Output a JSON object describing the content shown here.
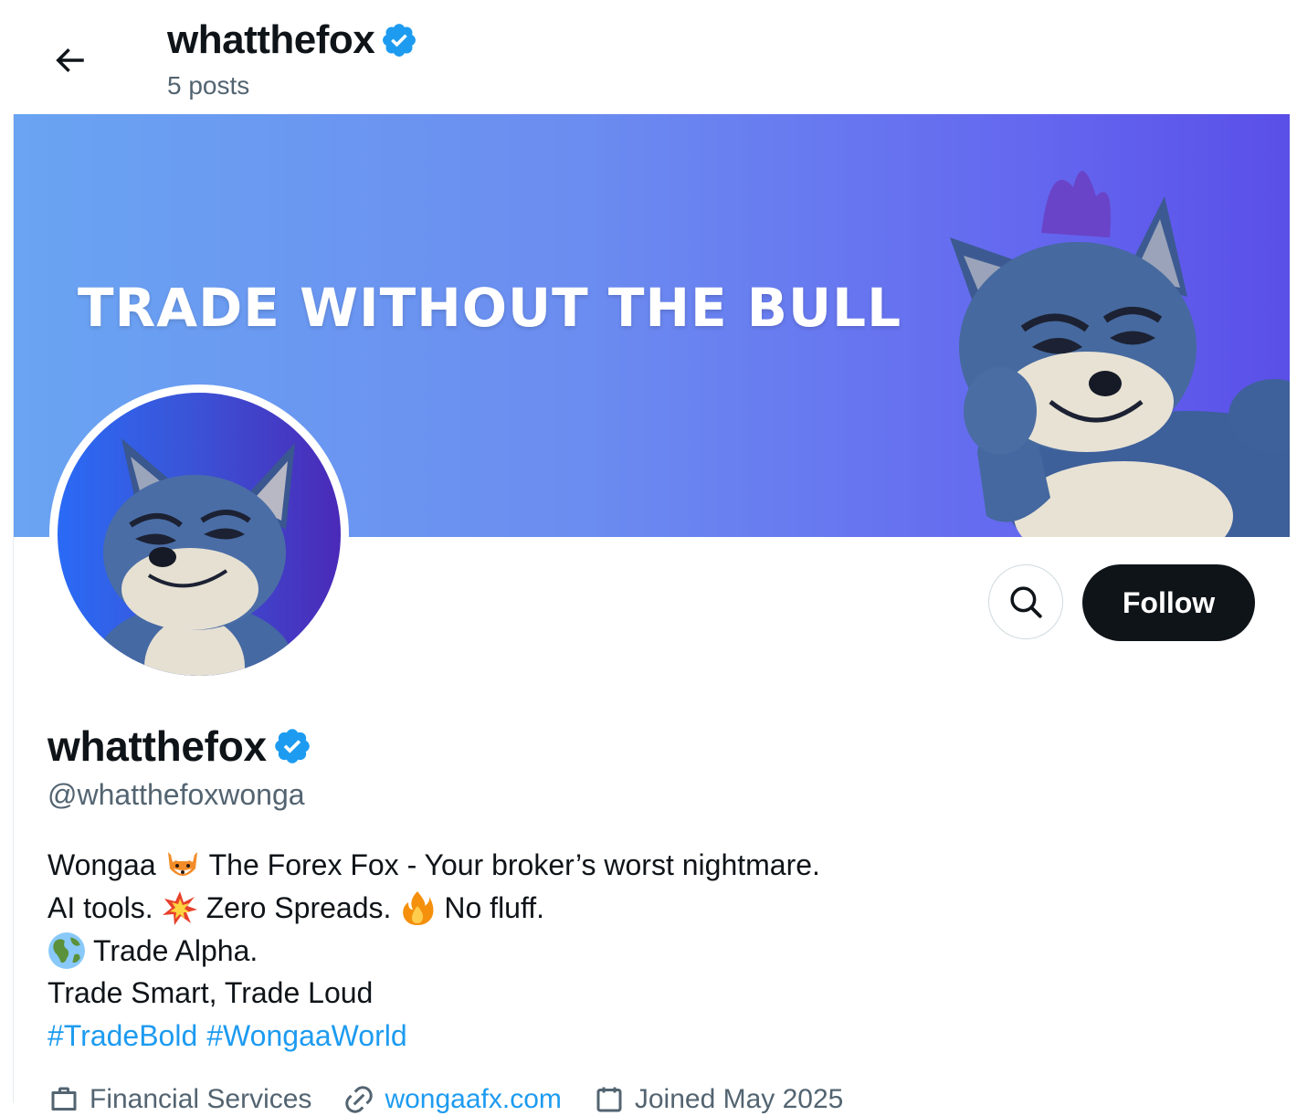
{
  "header": {
    "back_icon": "arrow-left-icon",
    "title": "whatthefox",
    "subtitle": "5 posts"
  },
  "banner": {
    "text": "TRADE WITHOUT THE BULL",
    "gradient_start": "#6aa4f2",
    "gradient_end": "#5a4fe8"
  },
  "profile": {
    "display_name": "whatthefox",
    "handle": "@whatthefoxwonga",
    "verified_color": "#1d9bf0"
  },
  "actions": {
    "search_icon": "search-icon",
    "follow_label": "Follow"
  },
  "bio": {
    "line1_a": "Wongaa",
    "line1_b": "The Forex Fox - Your broker’s worst nightmare.",
    "line2_a": "AI tools.",
    "line2_b": "Zero Spreads.",
    "line2_c": "No fluff.",
    "line3": "Trade Alpha.",
    "line4": "Trade Smart, Trade Loud",
    "hashtags": [
      "#TradeBold",
      "#WongaaWorld"
    ],
    "emojis": [
      "fox-emoji",
      "collision-emoji",
      "fire-emoji",
      "globe-emoji"
    ]
  },
  "meta": {
    "category": "Financial Services",
    "website": "wongaafx.com",
    "joined": "Joined May 2025"
  }
}
